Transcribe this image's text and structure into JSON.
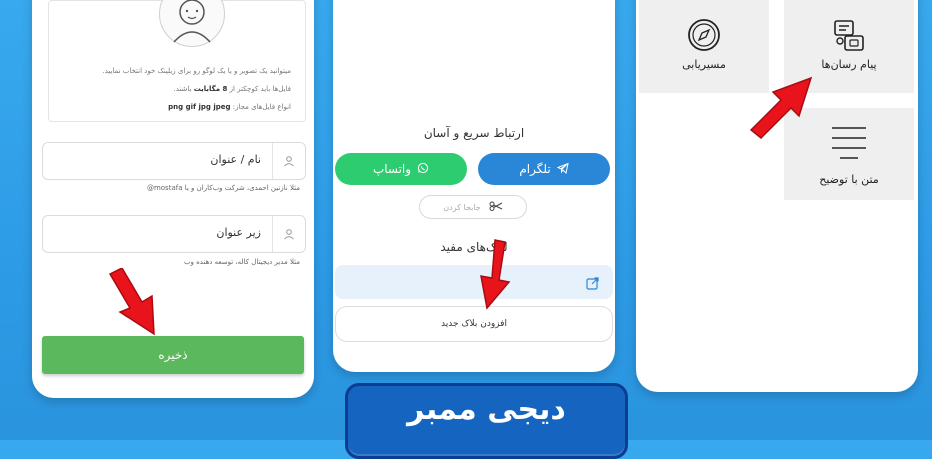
{
  "left_panel": {
    "upload_hint_1": "میتوانید یک تصویر و یا یک لوگو رو برای زیلینک خود انتخاب نمایید.",
    "upload_hint_2_prefix": "فایل‌ها باید کوچکتر از",
    "upload_hint_2_bold": "8 مگابایت",
    "upload_hint_2_suffix": "باشند.",
    "upload_hint_3_prefix": "انواع فایل‌های مجاز:",
    "upload_hint_3_bold": "png gif jpg jpeg",
    "name_field_label": "نام / عنوان",
    "name_field_help": "مثلا نازنین احمدی، شرکت وب‌کاران و یا mostafa@",
    "subtitle_field_label": "زیر عنوان",
    "subtitle_field_help": "مثلا مدیر دیجیتال کاله، توسعه دهنده وب",
    "save_button": "ذخیره"
  },
  "middle_panel": {
    "quick_contact_title": "ارتباط سریع و آسان",
    "telegram_button": "تلگرام",
    "whatsapp_button": "واتساپ",
    "reorder_chip": "جابجا کردن",
    "useful_links_title": "لینک‌های مفید",
    "add_block_button": "افزودن بلاک جدید"
  },
  "right_panel": {
    "messengers_tile": "پیام رسان‌ها",
    "routing_tile": "مسیریابی",
    "text_desc_tile": "متن با توضیح"
  },
  "banner": {
    "logo_text": "دیجی ممبر"
  },
  "colors": {
    "background": "#2d9be6",
    "save_green": "#5cb85c",
    "telegram_blue": "#2a87d8",
    "whatsapp_green": "#2ecc71",
    "arrow_red": "#e8131b",
    "banner_blue": "#1565c0"
  }
}
